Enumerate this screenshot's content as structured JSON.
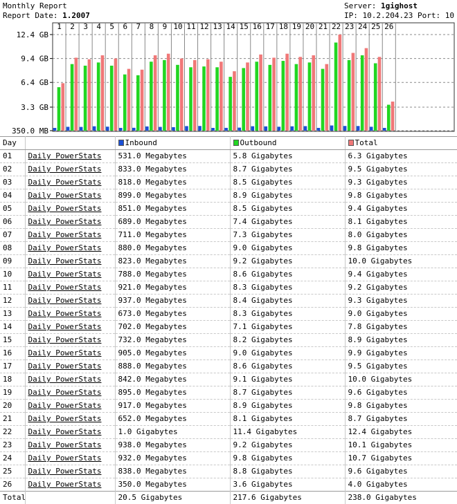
{
  "header": {
    "title": "Monthly Report",
    "report_date_label": "Report Date: ",
    "report_date": "1.2007",
    "server_label": "Server: ",
    "server": "1gighost",
    "ip_line": "IP: 10.2.204.23 Port: 10"
  },
  "colors": {
    "inbound": "#1a4fd6",
    "outbound": "#22d622",
    "total": "#f07878"
  },
  "table": {
    "columns": {
      "day": "Day",
      "link": "",
      "inbound": "Inbound",
      "outbound": "Outbound",
      "total": "Total"
    },
    "rows": [
      {
        "day": "01",
        "link": "Daily PowerStats",
        "inbound": "531.0 Megabytes",
        "outbound": "5.8 Gigabytes",
        "total": "6.3 Gigabytes"
      },
      {
        "day": "02",
        "link": "Daily PowerStats",
        "inbound": "833.0 Megabytes",
        "outbound": "8.7 Gigabytes",
        "total": "9.5 Gigabytes"
      },
      {
        "day": "03",
        "link": "Daily PowerStats",
        "inbound": "818.0 Megabytes",
        "outbound": "8.5 Gigabytes",
        "total": "9.3 Gigabytes"
      },
      {
        "day": "04",
        "link": "Daily PowerStats",
        "inbound": "899.0 Megabytes",
        "outbound": "8.9 Gigabytes",
        "total": "9.8 Gigabytes"
      },
      {
        "day": "05",
        "link": "Daily PowerStats",
        "inbound": "851.0 Megabytes",
        "outbound": "8.5 Gigabytes",
        "total": "9.4 Gigabytes"
      },
      {
        "day": "06",
        "link": "Daily PowerStats",
        "inbound": "689.0 Megabytes",
        "outbound": "7.4 Gigabytes",
        "total": "8.1 Gigabytes"
      },
      {
        "day": "07",
        "link": "Daily PowerStats",
        "inbound": "711.0 Megabytes",
        "outbound": "7.3 Gigabytes",
        "total": "8.0 Gigabytes"
      },
      {
        "day": "08",
        "link": "Daily PowerStats",
        "inbound": "880.0 Megabytes",
        "outbound": "9.0 Gigabytes",
        "total": "9.8 Gigabytes"
      },
      {
        "day": "09",
        "link": "Daily PowerStats",
        "inbound": "823.0 Megabytes",
        "outbound": "9.2 Gigabytes",
        "total": "10.0 Gigabytes"
      },
      {
        "day": "10",
        "link": "Daily PowerStats",
        "inbound": "788.0 Megabytes",
        "outbound": "8.6 Gigabytes",
        "total": "9.4 Gigabytes"
      },
      {
        "day": "11",
        "link": "Daily PowerStats",
        "inbound": "921.0 Megabytes",
        "outbound": "8.3 Gigabytes",
        "total": "9.2 Gigabytes"
      },
      {
        "day": "12",
        "link": "Daily PowerStats",
        "inbound": "937.0 Megabytes",
        "outbound": "8.4 Gigabytes",
        "total": "9.3 Gigabytes"
      },
      {
        "day": "13",
        "link": "Daily PowerStats",
        "inbound": "673.0 Megabytes",
        "outbound": "8.3 Gigabytes",
        "total": "9.0 Gigabytes"
      },
      {
        "day": "14",
        "link": "Daily PowerStats",
        "inbound": "702.0 Megabytes",
        "outbound": "7.1 Gigabytes",
        "total": "7.8 Gigabytes"
      },
      {
        "day": "15",
        "link": "Daily PowerStats",
        "inbound": "732.0 Megabytes",
        "outbound": "8.2 Gigabytes",
        "total": "8.9 Gigabytes"
      },
      {
        "day": "16",
        "link": "Daily PowerStats",
        "inbound": "905.0 Megabytes",
        "outbound": "9.0 Gigabytes",
        "total": "9.9 Gigabytes"
      },
      {
        "day": "17",
        "link": "Daily PowerStats",
        "inbound": "888.0 Megabytes",
        "outbound": "8.6 Gigabytes",
        "total": "9.5 Gigabytes"
      },
      {
        "day": "18",
        "link": "Daily PowerStats",
        "inbound": "842.0 Megabytes",
        "outbound": "9.1 Gigabytes",
        "total": "10.0 Gigabytes"
      },
      {
        "day": "19",
        "link": "Daily PowerStats",
        "inbound": "895.0 Megabytes",
        "outbound": "8.7 Gigabytes",
        "total": "9.6 Gigabytes"
      },
      {
        "day": "20",
        "link": "Daily PowerStats",
        "inbound": "917.0 Megabytes",
        "outbound": "8.9 Gigabytes",
        "total": "9.8 Gigabytes"
      },
      {
        "day": "21",
        "link": "Daily PowerStats",
        "inbound": "652.0 Megabytes",
        "outbound": "8.1 Gigabytes",
        "total": "8.7 Gigabytes"
      },
      {
        "day": "22",
        "link": "Daily PowerStats",
        "inbound": "1.0 Gigabytes",
        "outbound": "11.4 Gigabytes",
        "total": "12.4 Gigabytes"
      },
      {
        "day": "23",
        "link": "Daily PowerStats",
        "inbound": "938.0 Megabytes",
        "outbound": "9.2 Gigabytes",
        "total": "10.1 Gigabytes"
      },
      {
        "day": "24",
        "link": "Daily PowerStats",
        "inbound": "932.0 Megabytes",
        "outbound": "9.8 Gigabytes",
        "total": "10.7 Gigabytes"
      },
      {
        "day": "25",
        "link": "Daily PowerStats",
        "inbound": "838.0 Megabytes",
        "outbound": "8.8 Gigabytes",
        "total": "9.6 Gigabytes"
      },
      {
        "day": "26",
        "link": "Daily PowerStats",
        "inbound": "350.0 Megabytes",
        "outbound": "3.6 Gigabytes",
        "total": "4.0 Gigabytes"
      }
    ],
    "totals": {
      "label": "Total",
      "inbound": "20.5 Gigabytes",
      "outbound": "217.6 Gigabytes",
      "total": "238.0 Gigabytes"
    }
  },
  "chart_data": {
    "type": "bar",
    "categories": [
      "1",
      "2",
      "3",
      "4",
      "5",
      "6",
      "7",
      "8",
      "9",
      "10",
      "11",
      "12",
      "13",
      "14",
      "15",
      "16",
      "17",
      "18",
      "19",
      "20",
      "21",
      "22",
      "23",
      "24",
      "25",
      "26"
    ],
    "y_ticks": [
      "12.4 GB",
      "9.4 GB",
      "6.4 GB",
      "3.3 GB",
      "350.0 MB"
    ],
    "y_tick_values": [
      12.4,
      9.4,
      6.4,
      3.3,
      0.35
    ],
    "ylim": [
      0.35,
      12.4
    ],
    "grid": true,
    "series": [
      {
        "name": "Inbound",
        "values": [
          0.531,
          0.833,
          0.818,
          0.899,
          0.851,
          0.689,
          0.711,
          0.88,
          0.823,
          0.788,
          0.921,
          0.937,
          0.673,
          0.702,
          0.732,
          0.905,
          0.888,
          0.842,
          0.895,
          0.917,
          0.652,
          1.0,
          0.938,
          0.932,
          0.838,
          0.35
        ]
      },
      {
        "name": "Outbound",
        "values": [
          5.8,
          8.7,
          8.5,
          8.9,
          8.5,
          7.4,
          7.3,
          9.0,
          9.2,
          8.6,
          8.3,
          8.4,
          8.3,
          7.1,
          8.2,
          9.0,
          8.6,
          9.1,
          8.7,
          8.9,
          8.1,
          11.4,
          9.2,
          9.8,
          8.8,
          3.6
        ]
      },
      {
        "name": "Total",
        "values": [
          6.3,
          9.5,
          9.3,
          9.8,
          9.4,
          8.1,
          8.0,
          9.8,
          10.0,
          9.4,
          9.2,
          9.3,
          9.0,
          7.8,
          8.9,
          9.9,
          9.5,
          10.0,
          9.6,
          9.8,
          8.7,
          12.4,
          10.1,
          10.7,
          9.6,
          4.0
        ]
      }
    ]
  }
}
